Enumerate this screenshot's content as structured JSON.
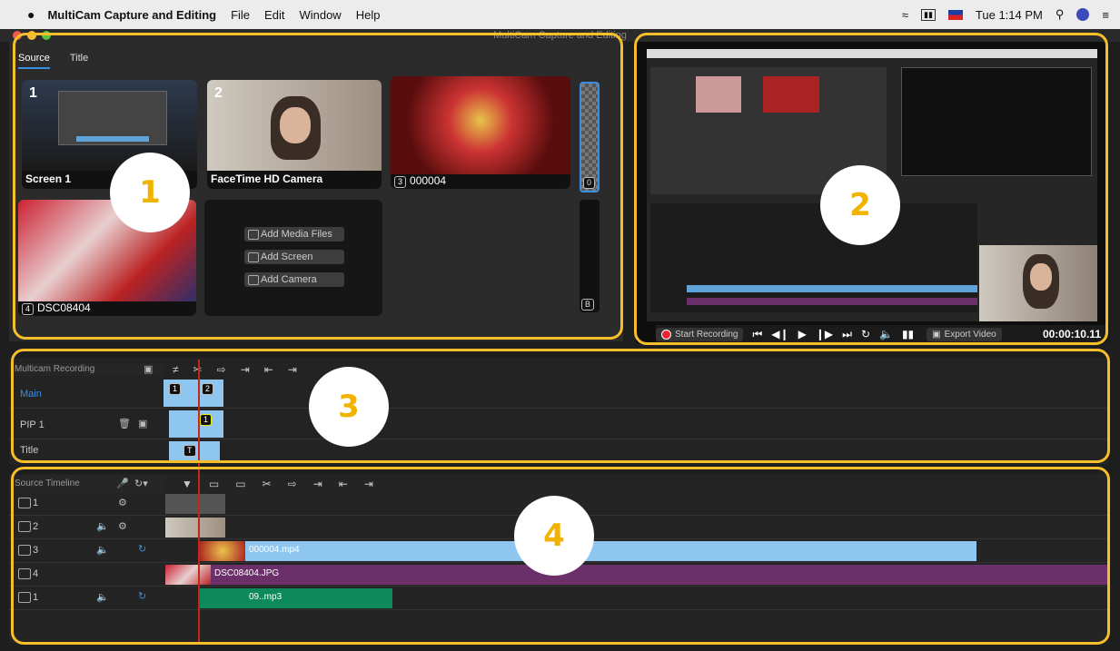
{
  "menubar": {
    "app": "MultiCam Capture and Editing",
    "menus": [
      "File",
      "Edit",
      "Window",
      "Help"
    ],
    "clock": "Tue 1:14 PM"
  },
  "window_title": "MultiCam Capture and Editing",
  "source_panel": {
    "tabs": [
      "Source",
      "Title"
    ],
    "tiles": [
      {
        "num": "1",
        "label": "Screen 1"
      },
      {
        "num": "2",
        "label": "FaceTime HD Camera"
      },
      {
        "num": "3",
        "label": "000004"
      },
      {
        "num": "4",
        "label": "DSC08404"
      }
    ],
    "side_badges": [
      "0",
      "B"
    ],
    "add_buttons": [
      "Add Media Files",
      "Add Screen",
      "Add Camera"
    ]
  },
  "controls": {
    "start_recording": "Start Recording",
    "export_video": "Export Video",
    "timecode": "00:00:10.11"
  },
  "multicam": {
    "header": "Multicam Recording",
    "tracks": [
      "Main",
      "PIP 1",
      "Title"
    ],
    "clip_markers": [
      "1",
      "2",
      "1",
      "T"
    ]
  },
  "source_timeline": {
    "header": "Source Timeline",
    "tracks": [
      "1",
      "2",
      "3",
      "4",
      "1"
    ],
    "clips": [
      "000004.mp4",
      "DSC08404.JPG",
      "09..mp3"
    ]
  },
  "circles": [
    "1",
    "2",
    "3",
    "4"
  ],
  "colors": {
    "accent_yellow": "#f5be2a",
    "clip_blue": "#8fc6ef",
    "clip_purple": "#6b2f6a",
    "clip_green": "#0d8a5c",
    "playhead": "#c0281b"
  }
}
